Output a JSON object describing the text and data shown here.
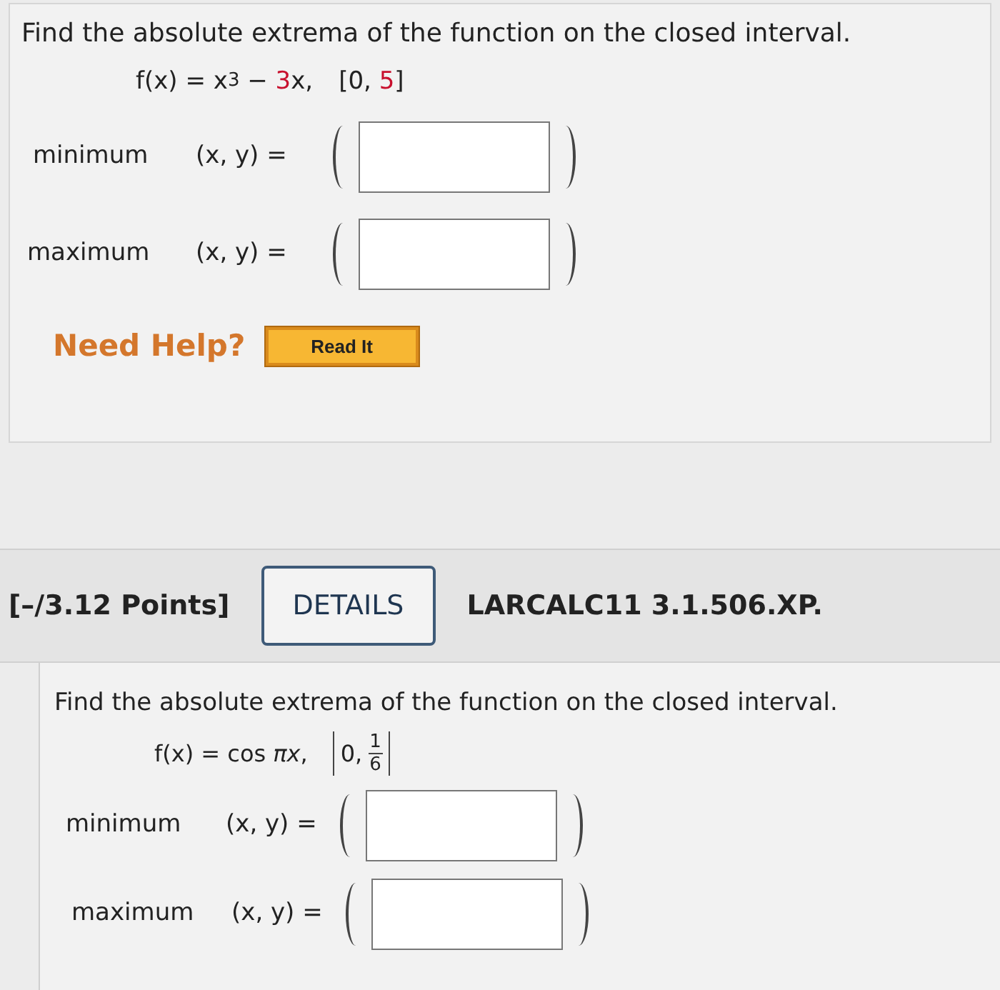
{
  "problem_1": {
    "prompt": "Find the absolute extrema of the function on the closed interval.",
    "formula": [
      {
        "kind": "plain",
        "text": "f(x) = x"
      },
      {
        "kind": "sup",
        "text": "3"
      },
      {
        "kind": "plain",
        "text": " − "
      },
      {
        "kind": "param",
        "text": "3"
      },
      {
        "kind": "plain",
        "text": "x,"
      }
    ],
    "interval": [
      {
        "kind": "plain",
        "text": "[0, "
      },
      {
        "kind": "param",
        "text": "5"
      },
      {
        "kind": "plain",
        "text": "]"
      }
    ],
    "answers": [
      {
        "label": "minimum",
        "pair": "(x, y) ="
      },
      {
        "label": "maximum",
        "pair": "(x, y) ="
      }
    ],
    "help": {
      "label": "Need Help?",
      "button": "Read It"
    }
  },
  "problem_2": {
    "header": {
      "points": "[–/3.12 Points]",
      "details_button": "DETAILS",
      "code": "LARCALC11 3.1.506.XP."
    },
    "prompt": "Find the absolute extrema of the function on the closed interval.",
    "formula": [
      {
        "kind": "plain",
        "text": "f(x) = cos "
      },
      {
        "kind": "italic",
        "text": "πx"
      },
      {
        "kind": "plain",
        "text": ","
      }
    ],
    "interval": {
      "start": "0,",
      "numerator": "1",
      "denominator": "6"
    },
    "answers": [
      {
        "label": "minimum",
        "pair": "(x, y) ="
      },
      {
        "label": "maximum",
        "pair": "(x, y) ="
      }
    ]
  }
}
